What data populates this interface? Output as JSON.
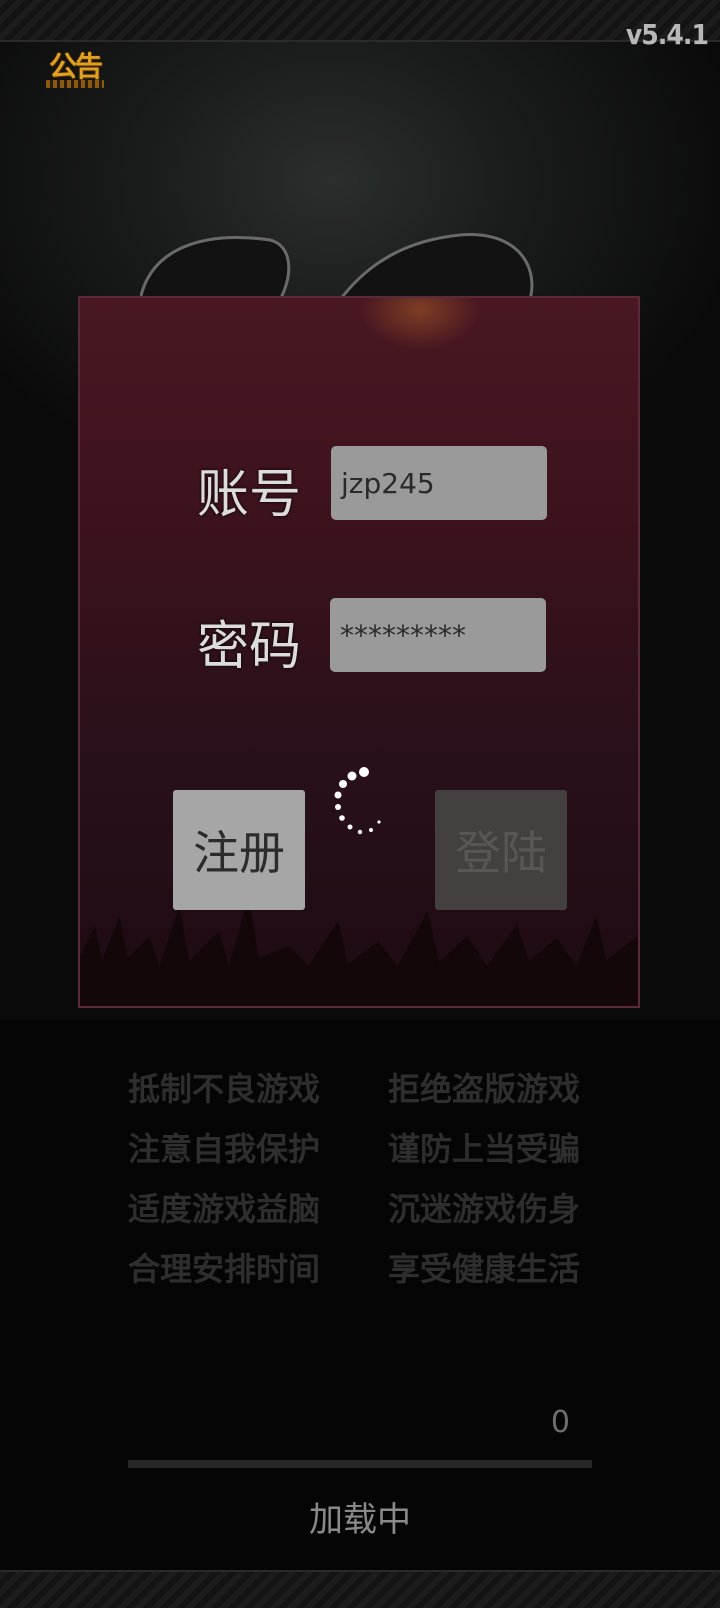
{
  "version": "v5.4.1",
  "notice": {
    "label": "公告"
  },
  "login": {
    "account_label": "账号",
    "account_value": "jzp245",
    "password_label": "密码",
    "password_value": "*********",
    "register_label": "注册",
    "login_label": "登陆"
  },
  "advice": [
    "抵制不良游戏",
    "拒绝盗版游戏",
    "注意自我保护",
    "谨防上当受骗",
    "适度游戏益脑",
    "沉迷游戏伤身",
    "合理安排时间",
    "享受健康生活"
  ],
  "progress": {
    "value_text": "0",
    "percent": 0
  },
  "loading_text": "加载中",
  "colors": {
    "accent_gold": "#e0a020",
    "panel": "#3a121c"
  }
}
